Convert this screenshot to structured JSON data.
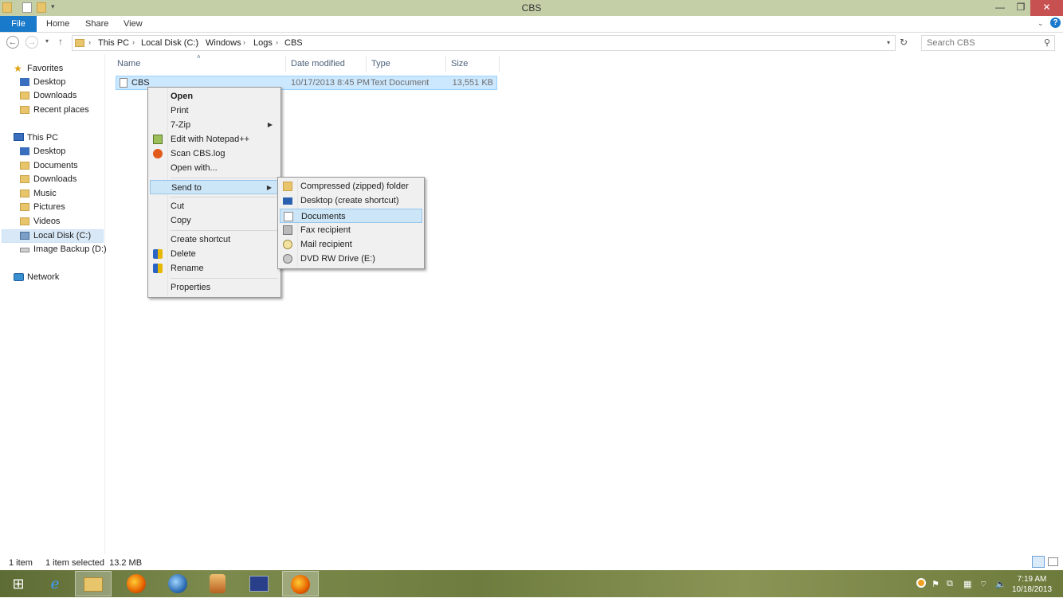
{
  "window": {
    "title": "CBS",
    "controls": {
      "minimize": "—",
      "maximize": "❐",
      "close": "✕"
    }
  },
  "ribbon": {
    "tabs": [
      "File",
      "Home",
      "Share",
      "View"
    ]
  },
  "address": {
    "breadcrumbs": [
      "This PC",
      "Local Disk (C:)",
      "Windows",
      "Logs",
      "CBS"
    ],
    "search_placeholder": "Search CBS"
  },
  "nav": {
    "favorites": {
      "label": "Favorites",
      "items": [
        "Desktop",
        "Downloads",
        "Recent places"
      ]
    },
    "this_pc": {
      "label": "This PC",
      "items": [
        "Desktop",
        "Documents",
        "Downloads",
        "Music",
        "Pictures",
        "Videos",
        "Local Disk (C:)",
        "Image Backup (D:)"
      ]
    },
    "network": {
      "label": "Network"
    },
    "selected": "Local Disk (C:)"
  },
  "columns": {
    "name": "Name",
    "date": "Date modified",
    "type": "Type",
    "size": "Size"
  },
  "files": [
    {
      "name": "CBS",
      "date": "10/17/2013 8:45 PM",
      "type": "Text Document",
      "size": "13,551 KB",
      "selected": true
    }
  ],
  "context_menu": {
    "items": [
      "Open",
      "Print",
      "7-Zip",
      "Edit with Notepad++",
      "Scan CBS.log",
      "Open with...",
      "Send to",
      "Cut",
      "Copy",
      "Create shortcut",
      "Delete",
      "Rename",
      "Properties"
    ],
    "highlighted": "Send to"
  },
  "send_to_menu": {
    "items": [
      "Compressed (zipped) folder",
      "Desktop (create shortcut)",
      "Documents",
      "Fax recipient",
      "Mail recipient",
      "DVD RW Drive (E:)"
    ],
    "highlighted": "Documents"
  },
  "status": {
    "count": "1 item",
    "selection": "1 item selected  13.2 MB"
  },
  "taskbar": {
    "apps": [
      "start-icon",
      "internet-explorer-icon",
      "file-explorer-icon",
      "firefox-icon",
      "thunderbird-icon",
      "app-icon",
      "task-manager-icon",
      "firefox-icon"
    ],
    "clock_time": "7:19 AM",
    "clock_date": "10/18/2013"
  }
}
